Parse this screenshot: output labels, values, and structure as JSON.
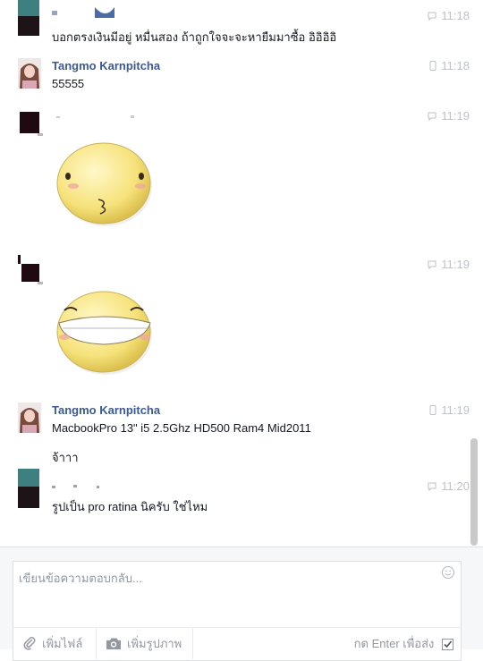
{
  "messages": [
    {
      "text": "บอกตรงเงินมีอยู่ หมื่นสอง ถ้าถูกใจจะจะหายืมมาซื้อ อิอิอิอิ",
      "time": "11:18"
    },
    {
      "sender": "Tangmo Karnpitcha",
      "text": "55555",
      "time": "11:18"
    },
    {
      "time": "11:19",
      "sticker": "kiss-sticker"
    },
    {
      "time": "11:19",
      "sticker": "grin-sticker"
    },
    {
      "sender": "Tangmo Karnpitcha",
      "text": "MacbookPro 13\" i5 2.5Ghz HD500 Ram4 Mid2011",
      "text2": "จ้าาา",
      "time": "11:19"
    },
    {
      "text": "รูปเป็น pro ratina นิครับ ใช่ไหม",
      "time": "11:20"
    }
  ],
  "composer": {
    "placeholder": "เขียนข้อความตอบกลับ...",
    "add_files_label": "เพิ่มไฟล์",
    "add_photos_label": "เพิ่มรูปภาพ",
    "enter_to_send_label": "กด Enter เพื่อส่ง"
  },
  "colors": {
    "sender_name": "#3b5998",
    "time": "#bdc1c9",
    "sticker_face": "#f6e27a"
  }
}
